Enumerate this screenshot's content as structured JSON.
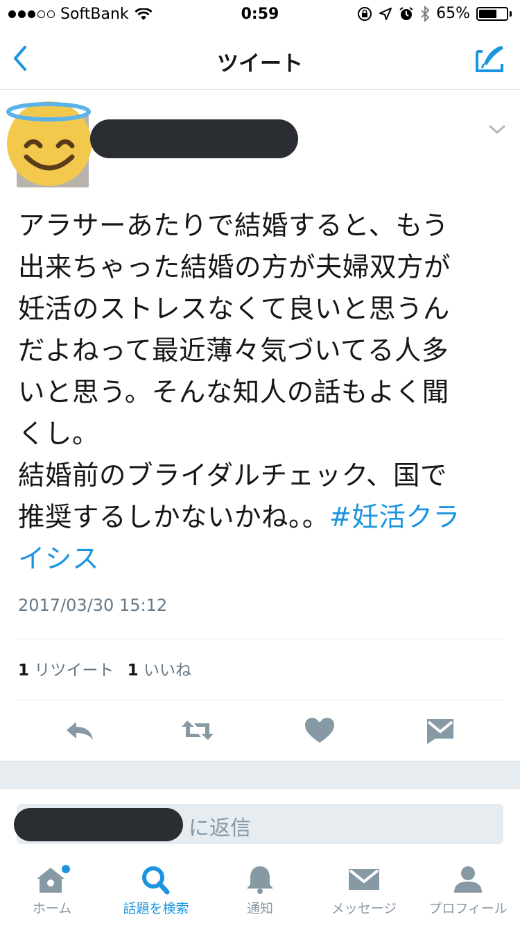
{
  "status_bar": {
    "carrier": "SoftBank",
    "time": "0:59",
    "battery": "65%",
    "battery_level": 0.65
  },
  "nav": {
    "title": "ツイート",
    "back_icon": "chevron-left-icon",
    "compose_icon": "compose-icon"
  },
  "tweet": {
    "avatar_icon": "smiling-face-with-halo-emoji",
    "lines": [
      "アラサーあたりで結婚すると、もう",
      "出来ちゃった結婚の方が夫婦双方が",
      "妊活のストレスなくて良いと思うん",
      "だよねって最近薄々気づいてる人多",
      "いと思う。そんな知人の話もよく聞",
      "くし。",
      "結婚前のブライダルチェック、国で"
    ],
    "last_line_text": "推奨するしかないかね。。",
    "hashtag_part1": "#妊活クラ",
    "hashtag_part2": "イシス",
    "timestamp": "2017/03/30 15:12",
    "retweet_count": "1",
    "retweet_label": "リツイート",
    "like_count": "1",
    "like_label": "いいね"
  },
  "actions": [
    "reply-icon",
    "retweet-icon",
    "like-heart-icon",
    "direct-message-icon"
  ],
  "reply": {
    "suffix": "に返信"
  },
  "tabs": [
    {
      "label": "ホーム",
      "icon": "home-icon",
      "active": false
    },
    {
      "label": "話題を検索",
      "icon": "search-icon",
      "active": true
    },
    {
      "label": "通知",
      "icon": "bell-icon",
      "active": false
    },
    {
      "label": "メッセージ",
      "icon": "envelope-icon",
      "active": false
    },
    {
      "label": "プロフィール",
      "icon": "profile-icon",
      "active": false
    }
  ],
  "colors": {
    "accent": "#1b95e0",
    "text": "#14171a",
    "muted": "#657786",
    "icon_gray": "#8899a6"
  }
}
